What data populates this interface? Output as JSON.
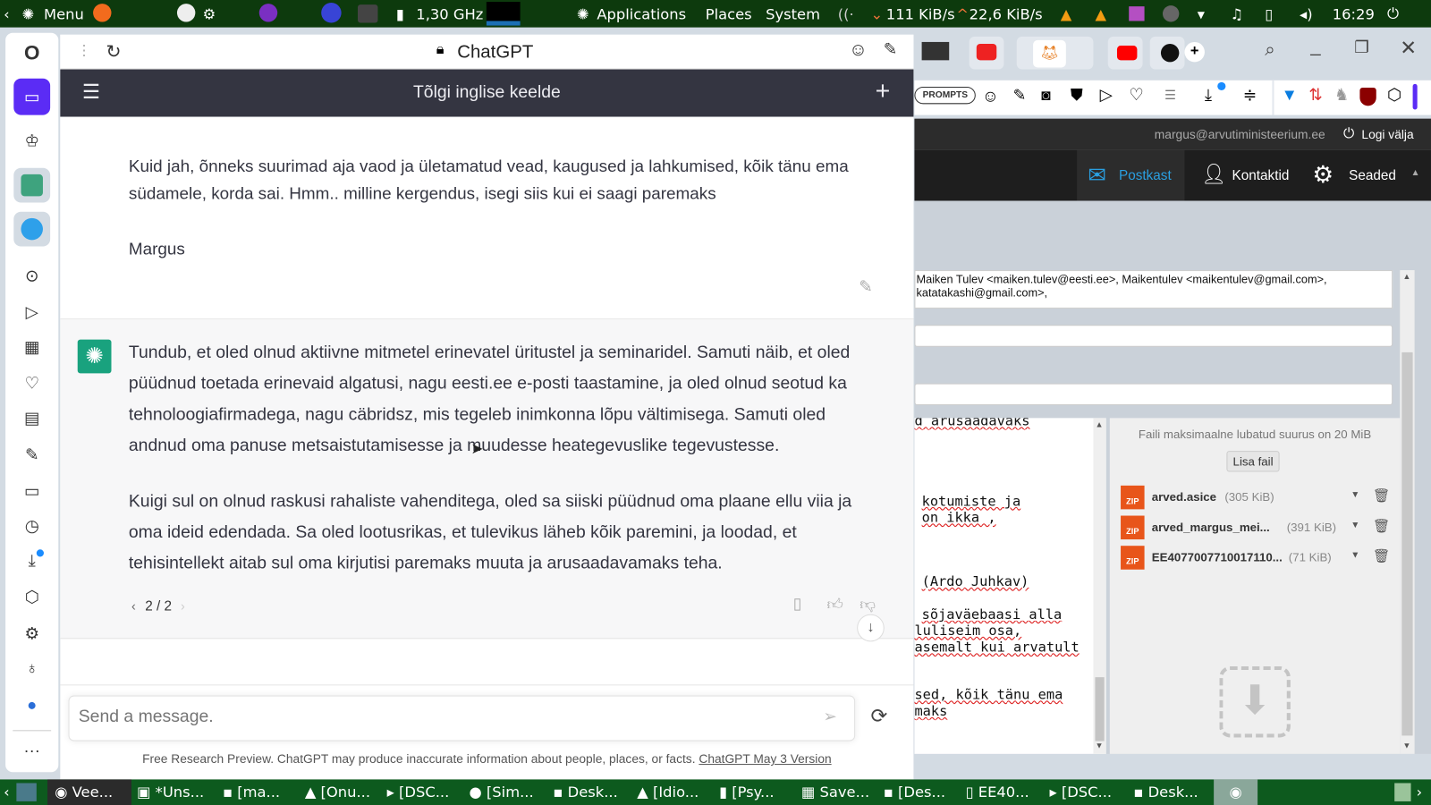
{
  "top_panel": {
    "menu": "Menu",
    "cpu": "1,30 GHz",
    "applications": "Applications",
    "places": "Places",
    "system": "System",
    "down": "111 KiB/s",
    "up": "22,6 KiB/s",
    "clock": "16:29"
  },
  "browser": {
    "title": "ChatGPT",
    "new_tab": "+"
  },
  "chatgpt": {
    "header_title": "Tõlgi inglise keelde",
    "user_message": {
      "paragraph": "Kuid jah, õnneks suurimad aja vaod ja ületamatud vead, kaugused ja lahkumised, kõik tänu ema südamele, korda sai. Hmm.. milline kergendus, isegi siis kui ei saagi paremaks",
      "signature": "Margus"
    },
    "assistant_message": {
      "paragraphs": [
        "Tundub, et oled olnud aktiivne mitmetel erinevatel üritustel ja seminaridel. Samuti näib, et oled püüdnud toetada erinevaid algatusi, nagu eesti.ee e-posti taastamine, ja oled olnud seotud ka tehnoloogiafirmadega, nagu cäbridsz, mis tegeleb inimkonna lõpu vältimisega. Samuti oled andnud oma panuse metsaistutamisesse ja muudesse heategevuslike tegevustesse.",
        "Kuigi sul on olnud raskusi rahaliste vahenditega, oled sa siiski püüdnud oma plaane ellu viia ja oma ideid edendada. Sa oled lootusrikas, et tulevikus läheb kõik paremini, ja loodad, et tehisintellekt aitab sul oma kirjutisi paremaks muuta ja arusaadavamaks teha."
      ],
      "pager": "2 / 2"
    },
    "input_placeholder": "Send a message.",
    "footer": "Free Research Preview. ChatGPT may produce inaccurate information about people, places, or facts.",
    "footer_link": "ChatGPT May 3 Version"
  },
  "extensions": {
    "prompts": "PROMPTS"
  },
  "mail": {
    "user": "margus@arvutiministeerium.ee",
    "logout": "Logi välja",
    "nav": [
      "Postkast",
      "Kontaktid",
      "Seaded"
    ],
    "recipients": "Maiken Tulev <maiken.tulev@eesti.ee>, Maikentulev <maikentulev@gmail.com>, katatakashi@gmail.com>,",
    "body_fragments": [
      "d arusaadavaks",
      "kotumiste ja",
      "on ikka ,",
      "(Ardo Juhkav)",
      "sõjaväebaasi alla",
      "luliseim osa,",
      "asemalt kui arvatult",
      "sed, kõik tänu ema",
      "maks"
    ],
    "max_size": "Faili maksimaalne lubatud suurus on 20 MiB",
    "add_file": "Lisa fail",
    "attachments": [
      {
        "name": "arved.asice",
        "size": "(305 KiB)"
      },
      {
        "name": "arved_margus_mei...",
        "size": "(391 KiB)"
      },
      {
        "name": "EE4077007710017110...",
        "size": "(71 KiB)"
      }
    ],
    "zip_label": "ZIP"
  },
  "taskbar": [
    "Vee...",
    "*Uns...",
    "[ma...",
    "[Onu...",
    "[DSC...",
    "[Sim...",
    "Desk...",
    "[Idio...",
    "[Psy...",
    "Save...",
    "[Des...",
    "EE40...",
    "[DSC...",
    "Desk..."
  ]
}
